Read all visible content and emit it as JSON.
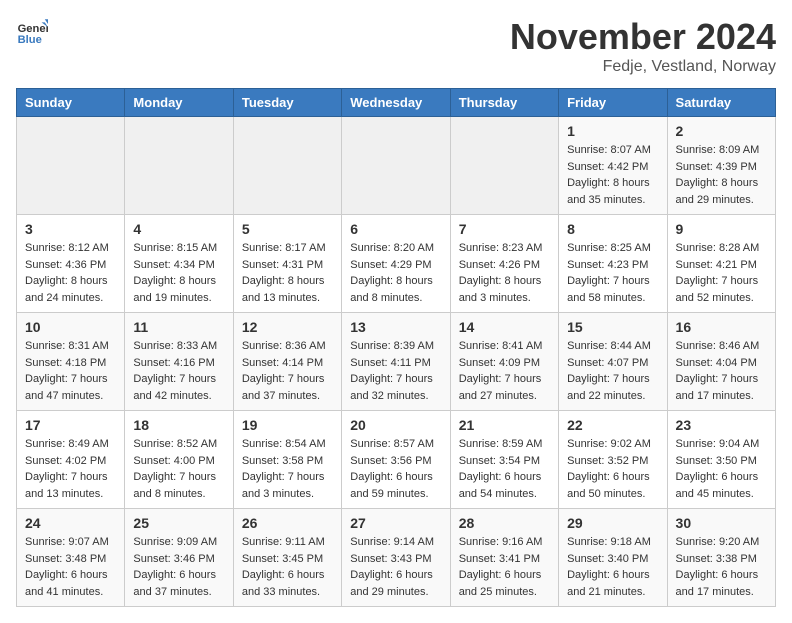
{
  "header": {
    "logo_general": "General",
    "logo_blue": "Blue",
    "title": "November 2024",
    "subtitle": "Fedje, Vestland, Norway"
  },
  "weekdays": [
    "Sunday",
    "Monday",
    "Tuesday",
    "Wednesday",
    "Thursday",
    "Friday",
    "Saturday"
  ],
  "weeks": [
    [
      {
        "day": "",
        "info": ""
      },
      {
        "day": "",
        "info": ""
      },
      {
        "day": "",
        "info": ""
      },
      {
        "day": "",
        "info": ""
      },
      {
        "day": "",
        "info": ""
      },
      {
        "day": "1",
        "info": "Sunrise: 8:07 AM\nSunset: 4:42 PM\nDaylight: 8 hours\nand 35 minutes."
      },
      {
        "day": "2",
        "info": "Sunrise: 8:09 AM\nSunset: 4:39 PM\nDaylight: 8 hours\nand 29 minutes."
      }
    ],
    [
      {
        "day": "3",
        "info": "Sunrise: 8:12 AM\nSunset: 4:36 PM\nDaylight: 8 hours\nand 24 minutes."
      },
      {
        "day": "4",
        "info": "Sunrise: 8:15 AM\nSunset: 4:34 PM\nDaylight: 8 hours\nand 19 minutes."
      },
      {
        "day": "5",
        "info": "Sunrise: 8:17 AM\nSunset: 4:31 PM\nDaylight: 8 hours\nand 13 minutes."
      },
      {
        "day": "6",
        "info": "Sunrise: 8:20 AM\nSunset: 4:29 PM\nDaylight: 8 hours\nand 8 minutes."
      },
      {
        "day": "7",
        "info": "Sunrise: 8:23 AM\nSunset: 4:26 PM\nDaylight: 8 hours\nand 3 minutes."
      },
      {
        "day": "8",
        "info": "Sunrise: 8:25 AM\nSunset: 4:23 PM\nDaylight: 7 hours\nand 58 minutes."
      },
      {
        "day": "9",
        "info": "Sunrise: 8:28 AM\nSunset: 4:21 PM\nDaylight: 7 hours\nand 52 minutes."
      }
    ],
    [
      {
        "day": "10",
        "info": "Sunrise: 8:31 AM\nSunset: 4:18 PM\nDaylight: 7 hours\nand 47 minutes."
      },
      {
        "day": "11",
        "info": "Sunrise: 8:33 AM\nSunset: 4:16 PM\nDaylight: 7 hours\nand 42 minutes."
      },
      {
        "day": "12",
        "info": "Sunrise: 8:36 AM\nSunset: 4:14 PM\nDaylight: 7 hours\nand 37 minutes."
      },
      {
        "day": "13",
        "info": "Sunrise: 8:39 AM\nSunset: 4:11 PM\nDaylight: 7 hours\nand 32 minutes."
      },
      {
        "day": "14",
        "info": "Sunrise: 8:41 AM\nSunset: 4:09 PM\nDaylight: 7 hours\nand 27 minutes."
      },
      {
        "day": "15",
        "info": "Sunrise: 8:44 AM\nSunset: 4:07 PM\nDaylight: 7 hours\nand 22 minutes."
      },
      {
        "day": "16",
        "info": "Sunrise: 8:46 AM\nSunset: 4:04 PM\nDaylight: 7 hours\nand 17 minutes."
      }
    ],
    [
      {
        "day": "17",
        "info": "Sunrise: 8:49 AM\nSunset: 4:02 PM\nDaylight: 7 hours\nand 13 minutes."
      },
      {
        "day": "18",
        "info": "Sunrise: 8:52 AM\nSunset: 4:00 PM\nDaylight: 7 hours\nand 8 minutes."
      },
      {
        "day": "19",
        "info": "Sunrise: 8:54 AM\nSunset: 3:58 PM\nDaylight: 7 hours\nand 3 minutes."
      },
      {
        "day": "20",
        "info": "Sunrise: 8:57 AM\nSunset: 3:56 PM\nDaylight: 6 hours\nand 59 minutes."
      },
      {
        "day": "21",
        "info": "Sunrise: 8:59 AM\nSunset: 3:54 PM\nDaylight: 6 hours\nand 54 minutes."
      },
      {
        "day": "22",
        "info": "Sunrise: 9:02 AM\nSunset: 3:52 PM\nDaylight: 6 hours\nand 50 minutes."
      },
      {
        "day": "23",
        "info": "Sunrise: 9:04 AM\nSunset: 3:50 PM\nDaylight: 6 hours\nand 45 minutes."
      }
    ],
    [
      {
        "day": "24",
        "info": "Sunrise: 9:07 AM\nSunset: 3:48 PM\nDaylight: 6 hours\nand 41 minutes."
      },
      {
        "day": "25",
        "info": "Sunrise: 9:09 AM\nSunset: 3:46 PM\nDaylight: 6 hours\nand 37 minutes."
      },
      {
        "day": "26",
        "info": "Sunrise: 9:11 AM\nSunset: 3:45 PM\nDaylight: 6 hours\nand 33 minutes."
      },
      {
        "day": "27",
        "info": "Sunrise: 9:14 AM\nSunset: 3:43 PM\nDaylight: 6 hours\nand 29 minutes."
      },
      {
        "day": "28",
        "info": "Sunrise: 9:16 AM\nSunset: 3:41 PM\nDaylight: 6 hours\nand 25 minutes."
      },
      {
        "day": "29",
        "info": "Sunrise: 9:18 AM\nSunset: 3:40 PM\nDaylight: 6 hours\nand 21 minutes."
      },
      {
        "day": "30",
        "info": "Sunrise: 9:20 AM\nSunset: 3:38 PM\nDaylight: 6 hours\nand 17 minutes."
      }
    ]
  ]
}
